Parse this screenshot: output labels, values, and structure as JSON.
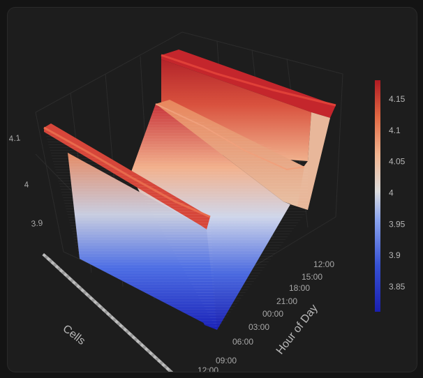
{
  "chart_data": {
    "type": "surface",
    "title": "",
    "axes": {
      "x": {
        "label": "Cells"
      },
      "y": {
        "label": "Hour of Day",
        "ticks": [
          "12:00",
          "15:00",
          "18:00",
          "21:00",
          "00:00",
          "03:00",
          "06:00",
          "09:00",
          "12:00"
        ]
      },
      "z": {
        "ticks": [
          "3.9",
          "4",
          "4.1"
        ],
        "range": [
          3.81,
          4.18
        ]
      }
    },
    "colorbar": {
      "ticks": [
        "4.15",
        "4.1",
        "4.05",
        "4",
        "3.95",
        "3.9",
        "3.85"
      ],
      "tick_values": [
        4.15,
        4.1,
        4.05,
        4.0,
        3.95,
        3.9,
        3.85
      ],
      "range": [
        3.81,
        4.18
      ],
      "colorscale": [
        "#1a1fb0",
        "#3b55d8",
        "#8aa6f0",
        "#dcdcdc",
        "#f4b08a",
        "#e06840",
        "#b01a22"
      ]
    },
    "profile": {
      "description_hours": [
        "12:00",
        "15:00",
        "18:00",
        "21:00",
        "00:00",
        "03:00",
        "06:00",
        "09:00",
        "12:00"
      ],
      "voltage_by_hour": [
        4.17,
        4.16,
        4.0,
        3.82,
        3.83,
        3.96,
        4.12,
        4.14,
        4.13
      ]
    }
  }
}
